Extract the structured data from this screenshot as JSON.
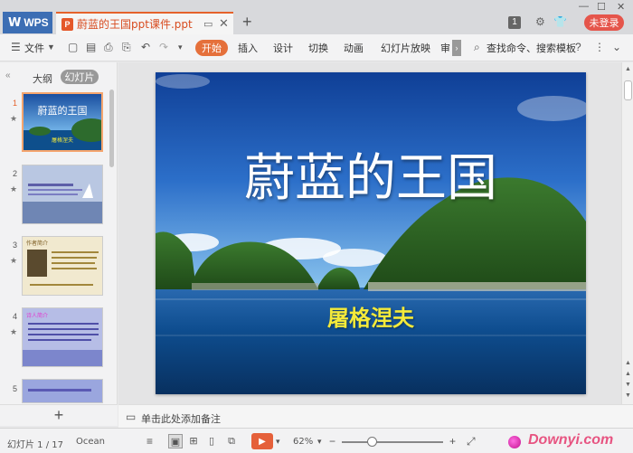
{
  "titlebar": {
    "app_tab": "WPS",
    "doc_tab_title": "蔚蓝的王国ppt课件.ppt",
    "badge": "1",
    "login_label": "未登录"
  },
  "menubar": {
    "file_label": "文件",
    "tabs": [
      "开始",
      "插入",
      "设计",
      "切换",
      "动画",
      "幻灯片放映",
      "审"
    ],
    "search_label": "查找命令、搜索模板"
  },
  "leftpanel": {
    "tab_outline": "大纲",
    "tab_slides": "幻灯片",
    "slides": [
      {
        "num": "1",
        "title": "蔚蓝的王国",
        "subtitle": "屠格涅夫"
      },
      {
        "num": "2"
      },
      {
        "num": "3",
        "title": "作者简介"
      },
      {
        "num": "4",
        "title": "诗人简介"
      },
      {
        "num": "5"
      }
    ]
  },
  "slide": {
    "title": "蔚蓝的王国",
    "author": "屠格涅夫"
  },
  "notes": {
    "placeholder": "单击此处添加备注"
  },
  "statusbar": {
    "slide_info": "幻灯片 1 / 17",
    "theme": "Ocean",
    "zoom": "62%",
    "zoom_level": 0.62,
    "watermark": "Downyi.com"
  },
  "colors": {
    "accent": "#e5703b",
    "wps_blue": "#3c6eb4",
    "login_red": "#e5554b",
    "title_white": "#ffffff",
    "author_yellow": "#f4ea3a"
  }
}
